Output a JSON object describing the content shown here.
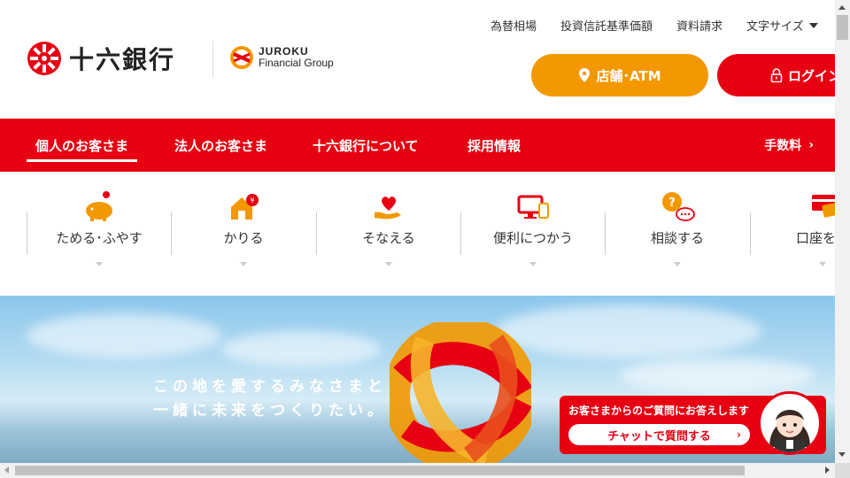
{
  "brand": {
    "name": "十六銀行",
    "group_line1": "JUROKU",
    "group_line2": "Financial Group",
    "red": "#e60012",
    "orange": "#f39800"
  },
  "utility_links": [
    "為替相場",
    "投資信託基準価額",
    "資料請求"
  ],
  "font_size_label": "文字サイズ",
  "buttons": {
    "atm": "店舗･ATM",
    "login": "ログイン"
  },
  "nav": {
    "items": [
      "個人のお客さま",
      "法人のお客さま",
      "十六銀行について",
      "採用情報"
    ],
    "active": "個人のお客さま",
    "fee": "手数料"
  },
  "categories": [
    {
      "label": "ためる･ふやす",
      "icon": "piggy-bank-icon"
    },
    {
      "label": "かりる",
      "icon": "house-yen-icon"
    },
    {
      "label": "そなえる",
      "icon": "heart-hand-icon"
    },
    {
      "label": "便利につかう",
      "icon": "devices-icon"
    },
    {
      "label": "相談する",
      "icon": "consult-icon"
    },
    {
      "label": "口座をひ",
      "icon": "card-icon"
    }
  ],
  "hero": {
    "line1": "この地を愛するみなさまと",
    "line2": "一緒に未来をつくりたい。"
  },
  "chat": {
    "prompt": "お客さまからのご質問にお答えします",
    "button": "チャットで質問する"
  }
}
